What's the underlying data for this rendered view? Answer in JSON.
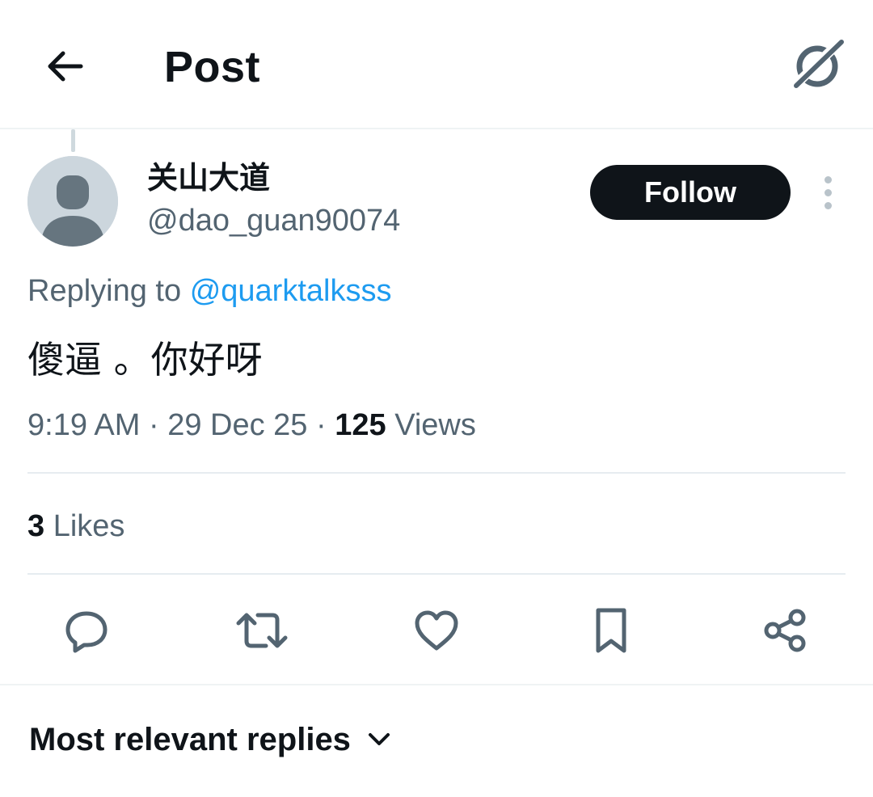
{
  "header": {
    "title": "Post",
    "back_icon": "arrow-left-icon",
    "grok_icon": "grok-icon"
  },
  "post": {
    "author": {
      "display_name": "关山大道",
      "handle": "@dao_guan90074",
      "avatar": "default-avatar"
    },
    "follow_label": "Follow",
    "replying_prefix": "Replying to",
    "replying_to": "@quarktalksss",
    "text": "傻逼 。你好呀",
    "time": "9:19 AM",
    "separator": "·",
    "date": "29 Dec 25",
    "views_count": "125",
    "views_label": "Views",
    "likes_count": "3",
    "likes_label": "Likes"
  },
  "actions": [
    {
      "name": "reply",
      "icon": "reply-icon"
    },
    {
      "name": "repost",
      "icon": "repost-icon"
    },
    {
      "name": "like",
      "icon": "heart-icon"
    },
    {
      "name": "bookmark",
      "icon": "bookmark-icon"
    },
    {
      "name": "share",
      "icon": "share-icon"
    }
  ],
  "replies_sort": {
    "label": "Most relevant replies",
    "icon": "chevron-down-icon"
  },
  "colors": {
    "text": "#0f1419",
    "secondary": "#536471",
    "accent": "#1d9bf0",
    "divider": "#e6ecf0"
  }
}
